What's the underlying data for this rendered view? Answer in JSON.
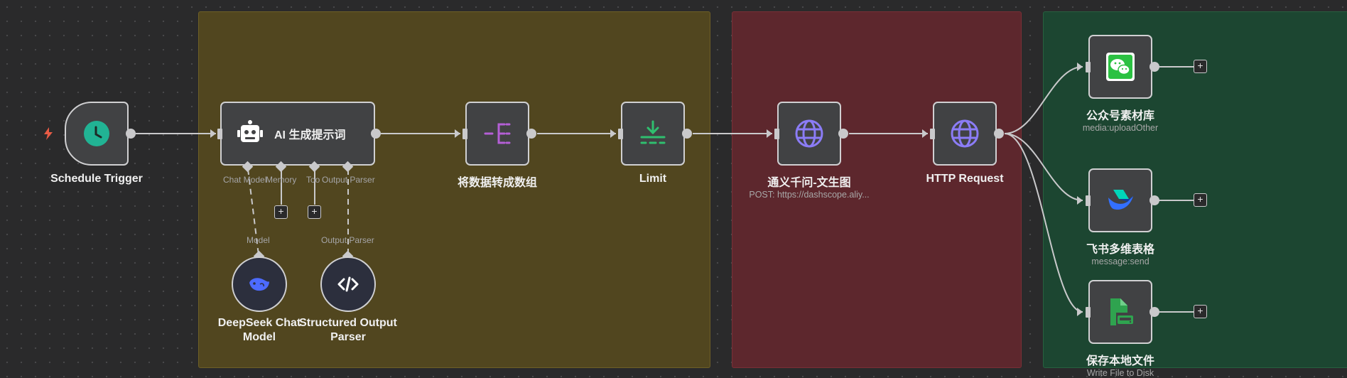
{
  "canvas": {
    "trigger_indicator": "bolt-icon"
  },
  "nodes": {
    "schedule_trigger": {
      "title": "Schedule Trigger",
      "icon": "clock-icon",
      "color": "#21b394"
    },
    "ai_prompt": {
      "title": "AI 生成提示词",
      "icon": "robot-icon"
    },
    "to_array": {
      "title": "将数据转成数组",
      "icon": "split-out-icon",
      "color": "#b45fd6"
    },
    "limit": {
      "title": "Limit",
      "icon": "limit-icon",
      "color": "#2fbf6f"
    },
    "tongyi": {
      "title": "通义千问-文生图",
      "subtitle": "POST: https://dashscope.aliy...",
      "icon": "globe-icon",
      "color": "#8b7cf6"
    },
    "http_request": {
      "title": "HTTP Request",
      "icon": "globe-icon",
      "color": "#8b7cf6"
    },
    "wechat": {
      "title": "公众号素材库",
      "subtitle": "media:uploadOther",
      "icon": "wechat-icon",
      "color": "#2bc142"
    },
    "feishu": {
      "title": "飞书多维表格",
      "subtitle": "message:send",
      "icon": "feishu-icon"
    },
    "save_file": {
      "title": "保存本地文件",
      "subtitle": "Write File to Disk",
      "icon": "file-icon",
      "color": "#2fa34f"
    },
    "deepseek": {
      "title_line1": "DeepSeek Chat",
      "title_line2": "Model",
      "icon": "deepseek-whale-icon",
      "color": "#4d6bfe"
    },
    "structured_parser": {
      "title_line1": "Structured Output",
      "title_line2": "Parser",
      "icon": "code-icon"
    }
  },
  "ai_ports": {
    "chat_model": "Chat Model",
    "memory": "Memory",
    "tool": "Too",
    "output_parser": "Output Parser"
  },
  "sub_ports": {
    "model": "Model",
    "output_parser": "Output Parser"
  },
  "buttons": {
    "add": "+"
  },
  "sticky_colors": {
    "yellow": "#51461f",
    "red": "#5d272d",
    "green": "#1c4631"
  }
}
